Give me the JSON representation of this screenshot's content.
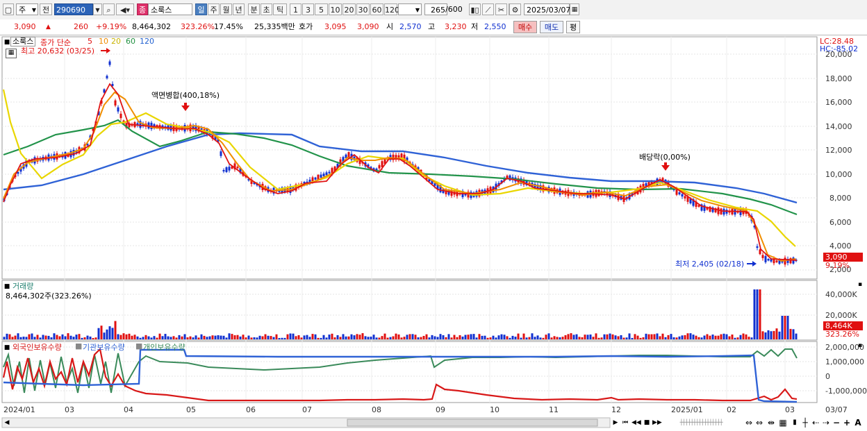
{
  "toolbar": {
    "period": "주",
    "prev_label": "전",
    "code": "290690",
    "stock_name": "소룩스",
    "name_badge": "종",
    "intervals": [
      "일",
      "주",
      "월",
      "년",
      "분",
      "초",
      "틱"
    ],
    "selected_interval": "일",
    "counts": [
      "1",
      "3",
      "5",
      "10",
      "20",
      "30",
      "60",
      "120"
    ],
    "view_count": "265",
    "view_total": "/600",
    "date": "2025/03/07"
  },
  "quote": {
    "price": "3,090",
    "change": "260",
    "change_pct": "+9.19%",
    "volume": "8,464,302",
    "volume_ratio": "323.26%",
    "turnover": "17.45%",
    "amount": "25,335백만",
    "bid_label": "호가",
    "bid1": "3,095",
    "bid2": "3,090",
    "open_label": "시",
    "open": "2,570",
    "high_label": "고",
    "high": "3,230",
    "low_label": "저",
    "low": "2,550",
    "buy_label": "매수",
    "sell_label": "매도",
    "eval_label": "평"
  },
  "price_panel": {
    "legend_name": "소룩스",
    "legend_price": "종가 단순",
    "ma": [
      {
        "period": "5",
        "color": "#e01010"
      },
      {
        "period": "10",
        "color": "#f08c00"
      },
      {
        "period": "20",
        "color": "#e8d000"
      },
      {
        "period": "60",
        "color": "#209040"
      },
      {
        "period": "120",
        "color": "#2060d0"
      }
    ],
    "high_note": "최고 20,632 (03/25)",
    "low_note": "최저 2,405 (02/18)",
    "event1": "액면병합(400,18%)",
    "event2": "배당락(0,00%)",
    "lc": "LC:28.48",
    "hc": "HC:-85.02",
    "y_labels": [
      "20,000",
      "18,000",
      "16,000",
      "14,000",
      "12,000",
      "10,000",
      "8,000",
      "6,000",
      "4,000",
      "2,000"
    ],
    "current": "3,090",
    "current_pct": "9.19%"
  },
  "volume_panel": {
    "title": "거래량",
    "value": "8,464,302주(323.26%)",
    "y_labels": [
      "40,000K",
      "20,000K"
    ],
    "current": "8,464K",
    "current_pct": "323.26%"
  },
  "holdings_panel": {
    "foreign": "외국인보유수량",
    "institution": "기관보유수량",
    "individual": "개인보유수량",
    "y_labels": [
      "2,000,000",
      "1,000,000",
      "0",
      "-1,000,000"
    ]
  },
  "x_labels": [
    "2024/01",
    "03",
    "04",
    "05",
    "06",
    "07",
    "08",
    "09",
    "10",
    "11",
    "12",
    "2025/01",
    "02",
    "03",
    "03/07"
  ]
}
